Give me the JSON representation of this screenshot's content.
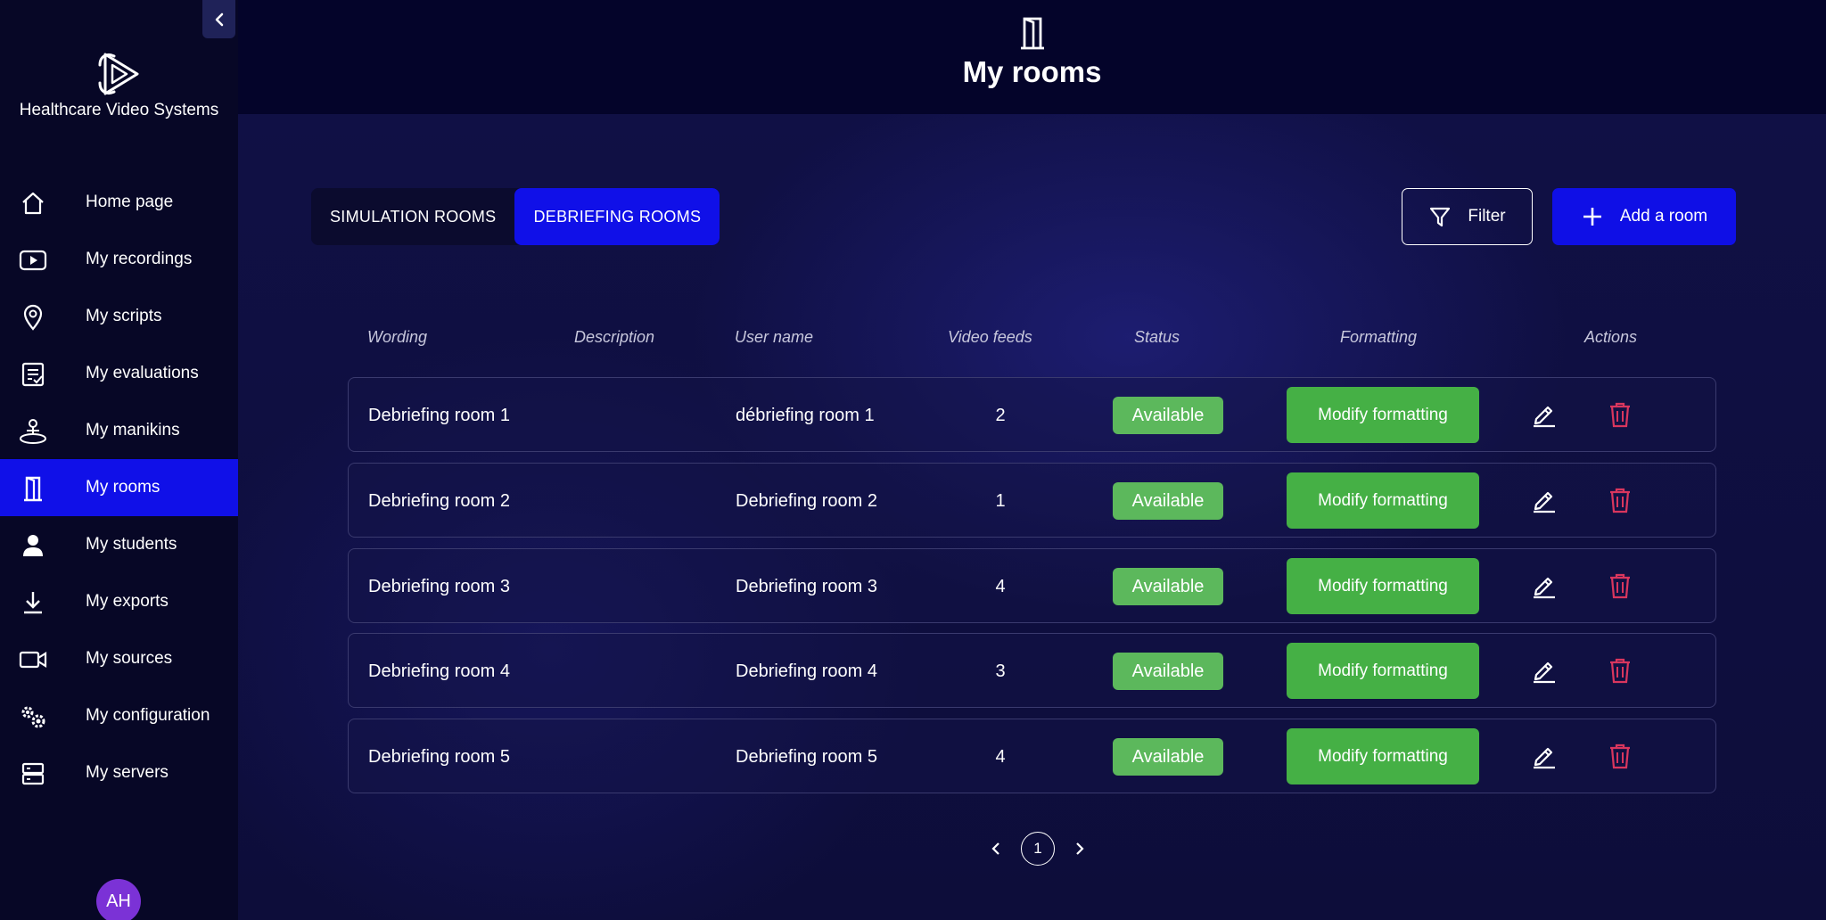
{
  "sidebar": {
    "brand": "Healthcare Video Systems",
    "items": [
      {
        "label": "Home page",
        "icon": "home-icon"
      },
      {
        "label": "My recordings",
        "icon": "play-icon"
      },
      {
        "label": "My scripts",
        "icon": "location-pin-icon"
      },
      {
        "label": "My evaluations",
        "icon": "checklist-icon"
      },
      {
        "label": "My manikins",
        "icon": "manikin-icon"
      },
      {
        "label": "My rooms",
        "icon": "door-icon",
        "active": true
      },
      {
        "label": "My students",
        "icon": "person-icon"
      },
      {
        "label": "My exports",
        "icon": "download-icon"
      },
      {
        "label": "My sources",
        "icon": "video-camera-icon"
      },
      {
        "label": "My configuration",
        "icon": "gears-icon"
      },
      {
        "label": "My servers",
        "icon": "server-icon"
      }
    ],
    "avatar": "AH"
  },
  "header": {
    "icon": "door-icon",
    "title": "My rooms"
  },
  "tabs": [
    {
      "label": "SIMULATION ROOMS",
      "active": false
    },
    {
      "label": "DEBRIEFING ROOMS",
      "active": true
    }
  ],
  "toolbar": {
    "filter_label": "Filter",
    "add_label": "Add a room"
  },
  "table": {
    "columns": [
      "Wording",
      "Description",
      "User name",
      "Video feeds",
      "Status",
      "Formatting",
      "Actions"
    ],
    "rows": [
      {
        "wording": "Debriefing room 1",
        "description": "",
        "user_name": "débriefing room 1",
        "video_feeds": "2",
        "status": "Available",
        "formatting": "Modify formatting"
      },
      {
        "wording": "Debriefing room 2",
        "description": "",
        "user_name": "Debriefing room 2",
        "video_feeds": "1",
        "status": "Available",
        "formatting": "Modify formatting"
      },
      {
        "wording": "Debriefing room 3",
        "description": "",
        "user_name": "Debriefing room 3",
        "video_feeds": "4",
        "status": "Available",
        "formatting": "Modify formatting"
      },
      {
        "wording": "Debriefing room 4",
        "description": "",
        "user_name": "Debriefing room 4",
        "video_feeds": "3",
        "status": "Available",
        "formatting": "Modify formatting"
      },
      {
        "wording": "Debriefing room 5",
        "description": "",
        "user_name": "Debriefing room 5",
        "video_feeds": "4",
        "status": "Available",
        "formatting": "Modify formatting"
      }
    ]
  },
  "pagination": {
    "current_page": "1"
  },
  "colors": {
    "accent": "#1010e8",
    "success": "#5cb85c",
    "danger": "#d9365e",
    "background": "#08082a"
  }
}
